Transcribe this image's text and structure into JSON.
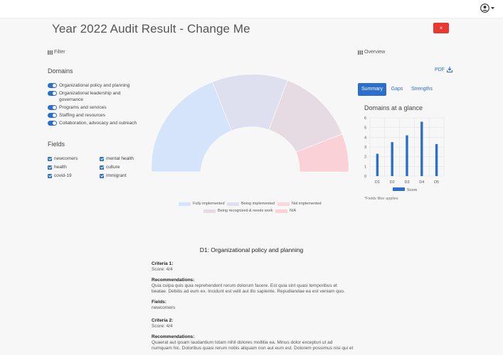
{
  "page": {
    "title": "Year 2022 Audit Result - Change Me",
    "close_label": "×"
  },
  "filter": {
    "label": "Filter"
  },
  "overview": {
    "label": "Overview"
  },
  "domains": {
    "title": "Domains",
    "items": [
      {
        "label": "Organizational policy and planning",
        "on": true
      },
      {
        "label": "Organizational leadership and governance",
        "on": true
      },
      {
        "label": "Programs and services",
        "on": true
      },
      {
        "label": "Staffing and resources",
        "on": true
      },
      {
        "label": "Collaboration, advocacy and outreach",
        "on": true
      }
    ]
  },
  "fields": {
    "title": "Fields",
    "items": [
      {
        "label": "newcomers",
        "checked": true
      },
      {
        "label": "mental health",
        "checked": true
      },
      {
        "label": "health",
        "checked": true
      },
      {
        "label": "culture",
        "checked": true
      },
      {
        "label": "covid-19",
        "checked": true
      },
      {
        "label": "immigrant",
        "checked": true
      }
    ]
  },
  "gauge_legend": {
    "items": [
      {
        "label": "Fully implemented",
        "color": "#d6e4fb"
      },
      {
        "label": "Being implemented",
        "color": "#dedfef"
      },
      {
        "label": "Not implemented",
        "color": "#f9d7dc"
      },
      {
        "label": "Being recognized & needs work",
        "color": "#e6dbe3"
      },
      {
        "label": "N/A",
        "color": "#fad1d6"
      }
    ]
  },
  "overview_panel": {
    "pdf_label": "PDF",
    "tabs": [
      {
        "label": "Summary",
        "active": true
      },
      {
        "label": "Gaps",
        "active": false
      },
      {
        "label": "Strengths",
        "active": false
      }
    ],
    "chart_title": "Domains at a glance",
    "note": "*Fields filter applies"
  },
  "chart_data": {
    "type": "bar",
    "title": "Domains at a glance",
    "categories": [
      "D1",
      "D2",
      "D3",
      "D4",
      "D5"
    ],
    "series": [
      {
        "name": "Score",
        "values": [
          2.3,
          3.5,
          4.2,
          5.6,
          3.3
        ]
      }
    ],
    "ylim": [
      0,
      6
    ],
    "yticks": [
      "0",
      "1",
      "2",
      "3",
      "4",
      "5",
      "6"
    ],
    "grid": true,
    "legend_position": "bottom",
    "bar_color": "#2b6ecb"
  },
  "details": {
    "heading": "D1: Organizational policy and planning",
    "criteria": [
      {
        "title": "Criteria 1:",
        "score": "Score: 4/4",
        "rec_label": "Recommendations:",
        "rec_line1": "Quia culpa quis quia reprehendent rerum dolorum facere. Est quia sint quasi temporibus et",
        "rec_line2": "beatae. Debitis ad eum ex. Incidunt est velit aut illo sapiente. Repudiandae ea est veniam quo.",
        "fields_label": "Fields:",
        "fields_value": "newcomers"
      },
      {
        "title": "Criteria 2:",
        "score": "Score: 4/4",
        "rec_label": "Recommendations:",
        "rec_line1": "Quaerat aut ipsam laudantium totam nihil dolores mollitia ea. Minus dolor excepturi ut ad",
        "rec_line2": "numquam hic. Doloribus quasi rerum nobis aliquam non aut eum est. Dolorem possimus nisi qui et"
      }
    ]
  }
}
